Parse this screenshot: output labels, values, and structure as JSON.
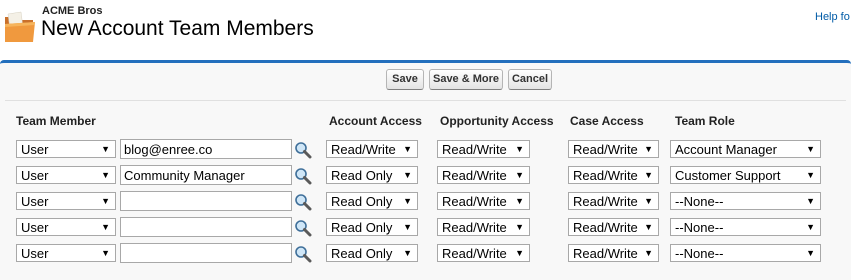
{
  "header": {
    "breadcrumb": "ACME Bros",
    "title": "New Account Team Members",
    "help_link": "Help fo"
  },
  "buttons": {
    "save": "Save",
    "save_more": "Save & More",
    "cancel": "Cancel"
  },
  "columns": {
    "team_member": "Team Member",
    "account_access": "Account Access",
    "opportunity_access": "Opportunity Access",
    "case_access": "Case Access",
    "team_role": "Team Role"
  },
  "rows": [
    {
      "type": "User",
      "name": "blog@enree.co",
      "account": "Read/Write",
      "opportunity": "Read/Write",
      "case": "Read/Write",
      "role": "Account Manager"
    },
    {
      "type": "User",
      "name": "Community Manager",
      "account": "Read Only",
      "opportunity": "Read/Write",
      "case": "Read/Write",
      "role": "Customer Support"
    },
    {
      "type": "User",
      "name": "",
      "account": "Read Only",
      "opportunity": "Read/Write",
      "case": "Read/Write",
      "role": "--None--"
    },
    {
      "type": "User",
      "name": "",
      "account": "Read Only",
      "opportunity": "Read/Write",
      "case": "Read/Write",
      "role": "--None--"
    },
    {
      "type": "User",
      "name": "",
      "account": "Read Only",
      "opportunity": "Read/Write",
      "case": "Read/Write",
      "role": "--None--"
    }
  ]
}
